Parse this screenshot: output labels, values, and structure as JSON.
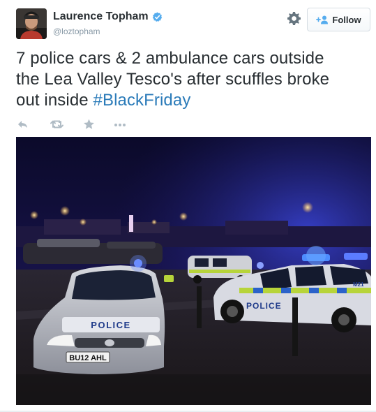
{
  "author": {
    "name": "Laurence Topham",
    "handle": "@loztopham",
    "verified": true,
    "avatar_icon": "user-avatar"
  },
  "header": {
    "settings_icon": "gear-icon",
    "follow_label": "Follow",
    "follow_icon": "add-user-icon"
  },
  "tweet": {
    "text_line_1": "7 police cars & 2 ambulance cars outside",
    "text_line_2": "the Lea Valley Tesco's after scuffles broke",
    "text_line_3": "out inside ",
    "hashtag": "#BlackFriday"
  },
  "actions": [
    {
      "icon": "reply-icon"
    },
    {
      "icon": "retweet-icon"
    },
    {
      "icon": "favorite-star-icon"
    },
    {
      "icon": "more-dots-icon"
    }
  ],
  "photo": {
    "police_livery_text": "POLICE",
    "number_plate": "BU12 AHL",
    "vehicle_marking": "M21"
  },
  "colors": {
    "text": "#292f33",
    "muted": "#8899a6",
    "link": "#2b7bb9",
    "verified": "#55acee"
  }
}
